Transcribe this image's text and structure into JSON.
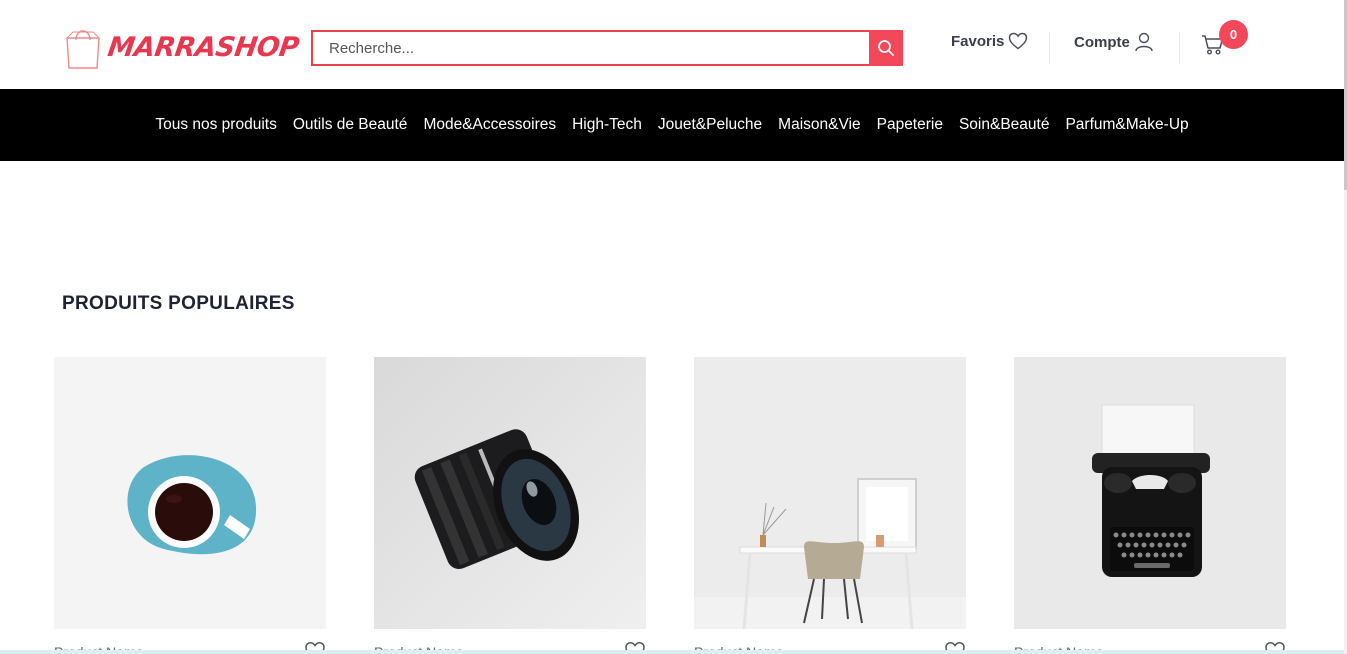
{
  "brand": {
    "name": "MARRASHOP",
    "color": "#e8384f"
  },
  "search": {
    "placeholder": "Recherche..."
  },
  "header": {
    "favoris_label": "Favoris",
    "compte_label": "Compte",
    "cart_count": "0"
  },
  "nav": {
    "items": [
      {
        "label": "Tous nos produits"
      },
      {
        "label": "Outils de Beauté"
      },
      {
        "label": "Mode&Accessoires"
      },
      {
        "label": "High-Tech"
      },
      {
        "label": "Jouet&Peluche"
      },
      {
        "label": "Maison&Vie"
      },
      {
        "label": "Papeterie"
      },
      {
        "label": "Soin&Beauté"
      },
      {
        "label": "Parfum&Make-Up"
      }
    ]
  },
  "section": {
    "title": "PRODUITS POPULAIRES"
  },
  "products": [
    {
      "name": "Product Name",
      "image": "coffee-cup-image"
    },
    {
      "name": "Product Name",
      "image": "camera-lens-image"
    },
    {
      "name": "Product Name",
      "image": "desk-chair-image"
    },
    {
      "name": "Product Name",
      "image": "typewriter-image"
    }
  ],
  "colors": {
    "accent": "#f3475a",
    "nav_bg": "#000000",
    "text_dark": "#2b2d42"
  }
}
